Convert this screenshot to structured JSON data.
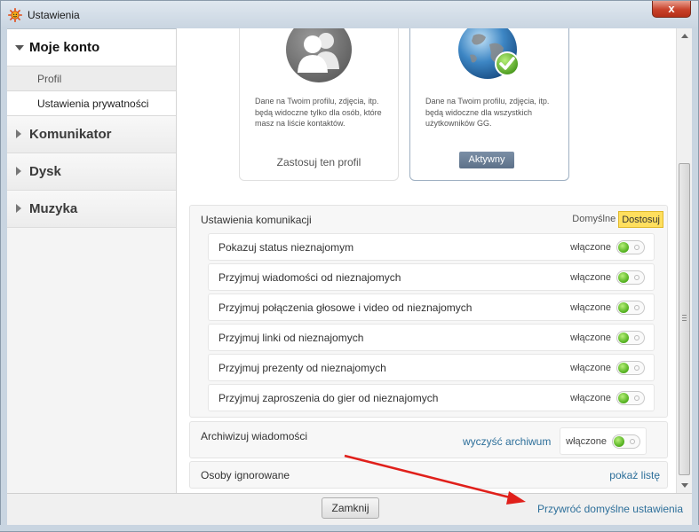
{
  "window": {
    "title": "Ustawienia",
    "close_label": "x"
  },
  "sidebar": {
    "sections": [
      {
        "label": "Moje konto",
        "open": true,
        "items": [
          "Profil",
          "Ustawienia prywatności"
        ]
      },
      {
        "label": "Komunikator"
      },
      {
        "label": "Dysk"
      },
      {
        "label": "Muzyka"
      }
    ]
  },
  "profiles": [
    {
      "description": "Dane na Twoim profilu, zdjęcia, itp. będą widoczne tylko dla osób, które masz na liście kontaktów.",
      "action": "Zastosuj ten profil",
      "icon": "user-group-icon"
    },
    {
      "description": "Dane na Twoim profilu, zdjęcia, itp. będą widoczne dla wszystkich użytkowników GG.",
      "badge": "Aktywny",
      "icon": "globe-check-icon"
    }
  ],
  "communication": {
    "title": "Ustawienia komunikacji",
    "mode_default": "Domyślne",
    "mode_custom": "Dostosuj",
    "rows": [
      {
        "label": "Pokazuj status nieznajomym",
        "state": "włączone"
      },
      {
        "label": "Przyjmuj wiadomości od nieznajomych",
        "state": "włączone"
      },
      {
        "label": "Przyjmuj połączenia głosowe i video od nieznajomych",
        "state": "włączone"
      },
      {
        "label": "Przyjmuj linki od nieznajomych",
        "state": "włączone"
      },
      {
        "label": "Przyjmuj prezenty od nieznajomych",
        "state": "włączone"
      },
      {
        "label": "Przyjmuj zaproszenia do gier od nieznajomych",
        "state": "włączone"
      }
    ]
  },
  "archive": {
    "title": "Archiwizuj wiadomości",
    "clear_link": "wyczyść archiwum",
    "state": "włączone"
  },
  "ignored": {
    "title": "Osoby ignorowane",
    "show_link": "pokaż listę"
  },
  "footer": {
    "close_button": "Zamknij",
    "restore_link": "Przywróć domyślne ustawienia"
  },
  "colors": {
    "annotation_arrow": "#e0201b",
    "link": "#2d6f9a",
    "toggle_on": "#4fae1c",
    "custom_highlight": "#ffdf5e"
  }
}
